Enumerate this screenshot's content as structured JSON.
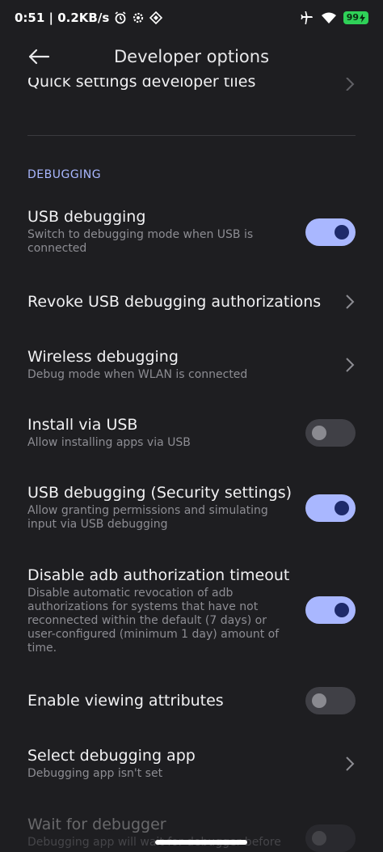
{
  "status": {
    "time_speed": "0:51 | 0.2KB/s",
    "battery": "99"
  },
  "header": {
    "title": "Developer options"
  },
  "top_item": {
    "title": "Quick settings developer tiles"
  },
  "section": {
    "label": "DEBUGGING"
  },
  "items": [
    {
      "title": "USB debugging",
      "subtitle": "Switch to debugging mode when USB is connected",
      "control": "toggle",
      "state": "on"
    },
    {
      "title": "Revoke USB debugging authorizations",
      "subtitle": "",
      "control": "chevron"
    },
    {
      "title": "Wireless debugging",
      "subtitle": "Debug mode when WLAN is connected",
      "control": "chevron"
    },
    {
      "title": "Install via USB",
      "subtitle": "Allow installing apps via USB",
      "control": "toggle",
      "state": "off"
    },
    {
      "title": "USB debugging (Security settings)",
      "subtitle": "Allow granting permissions and simulating input via USB debugging",
      "control": "toggle",
      "state": "on"
    },
    {
      "title": "Disable adb authorization timeout",
      "subtitle": "Disable automatic revocation of adb authorizations for systems that have not reconnected within the default (7 days) or user-configured (minimum 1 day) amount of time.",
      "control": "toggle",
      "state": "on"
    },
    {
      "title": "Enable viewing attributes",
      "subtitle": "",
      "control": "toggle",
      "state": "off"
    },
    {
      "title": "Select debugging app",
      "subtitle": "Debugging app isn't set",
      "control": "chevron"
    },
    {
      "title": "Wait for debugger",
      "subtitle": "Debugging app will wait for debugger before",
      "control": "toggle",
      "state": "off"
    }
  ],
  "colors": {
    "background": "#1e1e21",
    "accent": "#a9b7ff",
    "toggle_off": "#404046",
    "battery_green": "#2fd158"
  }
}
